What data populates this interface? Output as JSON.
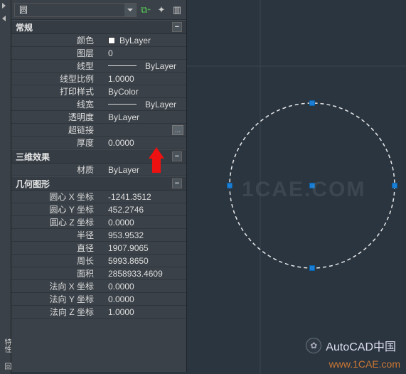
{
  "header": {
    "object_type": "圆"
  },
  "sections": {
    "general": {
      "title": "常规",
      "color_label": "颜色",
      "color_value": "ByLayer",
      "layer_label": "图层",
      "layer_value": "0",
      "linetype_label": "线型",
      "linetype_value": "ByLayer",
      "ltscale_label": "线型比例",
      "ltscale_value": "1.0000",
      "plot_label": "打印样式",
      "plot_value": "ByColor",
      "lw_label": "线宽",
      "lw_value": "ByLayer",
      "trans_label": "透明度",
      "trans_value": "ByLayer",
      "hyper_label": "超链接",
      "hyper_value": "",
      "thick_label": "厚度",
      "thick_value": "0.0000"
    },
    "threeD": {
      "title": "三维效果",
      "mat_label": "材质",
      "mat_value": "ByLayer"
    },
    "geom": {
      "title": "几何图形",
      "cx_label": "圆心 X 坐标",
      "cx_value": "-1241.3512",
      "cy_label": "圆心 Y 坐标",
      "cy_value": "452.2746",
      "cz_label": "圆心 Z 坐标",
      "cz_value": "0.0000",
      "r_label": "半径",
      "r_value": "953.9532",
      "d_label": "直径",
      "d_value": "1907.9065",
      "c_label": "周长",
      "c_value": "5993.8650",
      "a_label": "面积",
      "a_value": "2858933.4609",
      "nx_label": "法向 X 坐标",
      "nx_value": "0.0000",
      "ny_label": "法向 Y 坐标",
      "ny_value": "0.0000",
      "nz_label": "法向 Z 坐标",
      "nz_value": "1.0000"
    }
  },
  "vstrip": {
    "tab1": "特性",
    "tab2": "回"
  },
  "watermarks": {
    "w1": "1CAE.COM",
    "w2": "www.1CAE.com",
    "brand": "AutoCAD中国"
  }
}
